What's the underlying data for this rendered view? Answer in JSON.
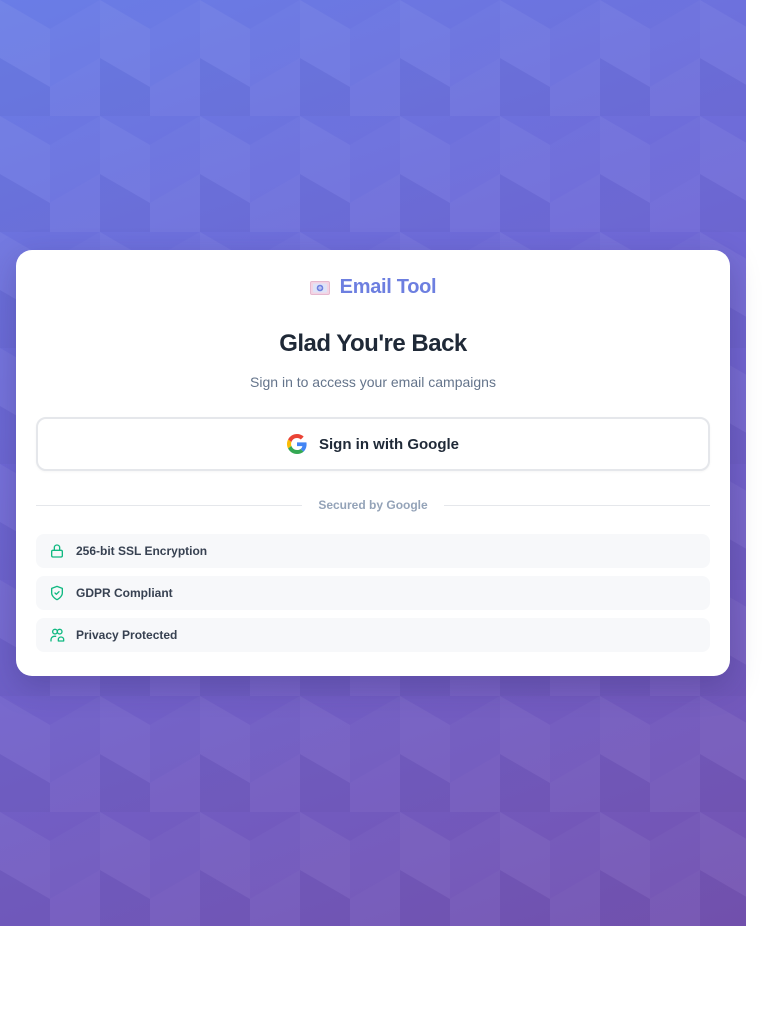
{
  "brand": {
    "name": "Email Tool",
    "icon": "email-logo-icon",
    "color": "#6d7fe0"
  },
  "login": {
    "title": "Glad You're Back",
    "subtitle": "Sign in to access your email campaigns",
    "google_button": {
      "label": "Sign in with Google",
      "icon": "google-icon"
    },
    "divider_text": "Secured by Google"
  },
  "features": [
    {
      "label": "256-bit SSL Encryption",
      "icon": "lock-icon"
    },
    {
      "label": "GDPR Compliant",
      "icon": "shield-check-icon"
    },
    {
      "label": "Privacy Protected",
      "icon": "users-icon"
    }
  ],
  "colors": {
    "accent_green": "#10b981",
    "gradient_start": "#6a7de6",
    "gradient_end": "#7452b0",
    "title": "#1f2937"
  }
}
